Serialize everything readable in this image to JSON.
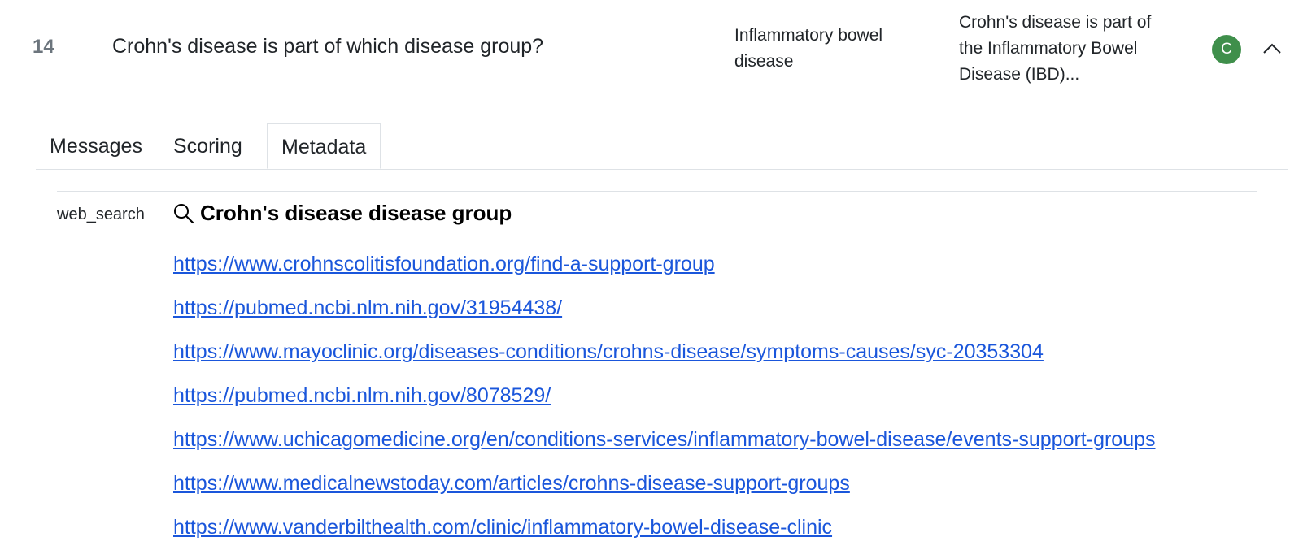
{
  "sample": {
    "index": "14",
    "question": "Crohn's disease is part of which disease group?",
    "target": "Inflammatory bowel disease",
    "answer": "Crohn's disease is part of the Inflammatory Bowel Disease (IBD)...",
    "score": "C",
    "score_color": "#3f8f4b"
  },
  "tabs": [
    {
      "label": "Messages"
    },
    {
      "label": "Scoring"
    },
    {
      "label": "Metadata"
    }
  ],
  "active_tab": "Metadata",
  "metadata": {
    "key": "web_search",
    "query": "Crohn's disease disease group",
    "links": [
      "https://www.crohnscolitisfoundation.org/find-a-support-group",
      "https://pubmed.ncbi.nlm.nih.gov/31954438/",
      "https://www.mayoclinic.org/diseases-conditions/crohns-disease/symptoms-causes/syc-20353304",
      "https://pubmed.ncbi.nlm.nih.gov/8078529/",
      "https://www.uchicagomedicine.org/en/conditions-services/inflammatory-bowel-disease/events-support-groups",
      "https://www.medicalnewstoday.com/articles/crohns-disease-support-groups",
      "https://www.vanderbilthealth.com/clinic/inflammatory-bowel-disease-clinic"
    ]
  },
  "icons": {
    "search": "search-icon",
    "collapse": "chevron-up-icon"
  },
  "colors": {
    "link": "#1a56db",
    "accent_green": "#3f8f4b",
    "muted": "#6c757d"
  }
}
